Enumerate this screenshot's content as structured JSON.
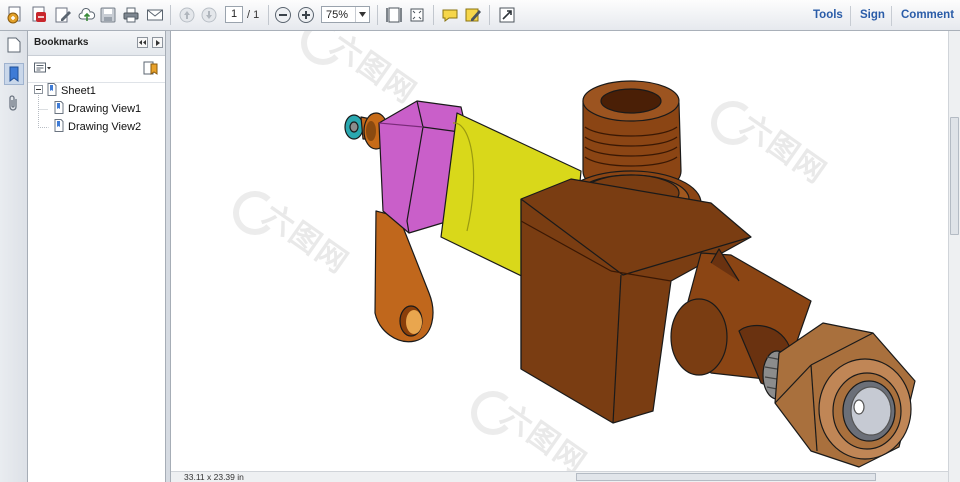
{
  "toolbar": {
    "page_current": "1",
    "page_total": "/ 1",
    "zoom": "75%",
    "links": {
      "tools": "Tools",
      "sign": "Sign",
      "comment": "Comment"
    },
    "icons": [
      "create-pdf-icon",
      "pdf-portfolio-icon",
      "edit-icon",
      "cloud-upload-icon",
      "save-icon",
      "print-icon",
      "email-icon",
      "previous-page-icon",
      "next-page-icon",
      "zoom-out-icon",
      "zoom-in-icon",
      "fit-page-icon",
      "fit-width-icon",
      "comment-bubble-icon",
      "highlight-icon",
      "full-screen-icon"
    ]
  },
  "rail": {
    "icons": [
      "page-thumbnails-icon",
      "bookmarks-icon",
      "attachments-icon"
    ]
  },
  "bookmarks": {
    "title": "Bookmarks",
    "items": [
      {
        "label": "Sheet1",
        "level": 0,
        "expanded": true
      },
      {
        "label": "Drawing View1",
        "level": 1
      },
      {
        "label": "Drawing View2",
        "level": 1
      }
    ]
  },
  "document": {
    "page_size": "33.11 x 23.39 in",
    "watermark": "六图网",
    "colors": {
      "body": "#7a3d12",
      "brass": "#a9703d",
      "yellow": "#d9d81a",
      "magenta": "#c95fc9",
      "orange_handle": "#c0671c",
      "teal": "#2aa8b0",
      "grey": "#8c8c8c"
    }
  },
  "colors": {
    "accent_link": "#2a5ca8",
    "toolbar_bg": "#eceff3"
  }
}
